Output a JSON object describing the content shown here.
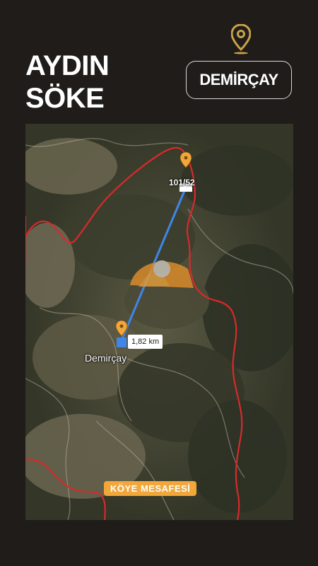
{
  "header": {
    "province": "AYDIN",
    "district": "SÖKE",
    "village_badge": "DEMİRÇAY"
  },
  "map": {
    "parcel_label": "101/52",
    "village_label": "Demirçay",
    "distance": "1,82 km",
    "caption": "KÖYE MESAFESİ"
  },
  "colors": {
    "background": "#1f1c1a",
    "pin": "#f1a73a",
    "route_line": "#3f86e8",
    "boundary": "#d82a2a",
    "caption_bg": "#f1a73a"
  },
  "icons": {
    "top": "location-pin-icon",
    "parcel": "map-pin-icon",
    "village": "map-pin-icon",
    "watermark": "logo-watermark-icon"
  }
}
